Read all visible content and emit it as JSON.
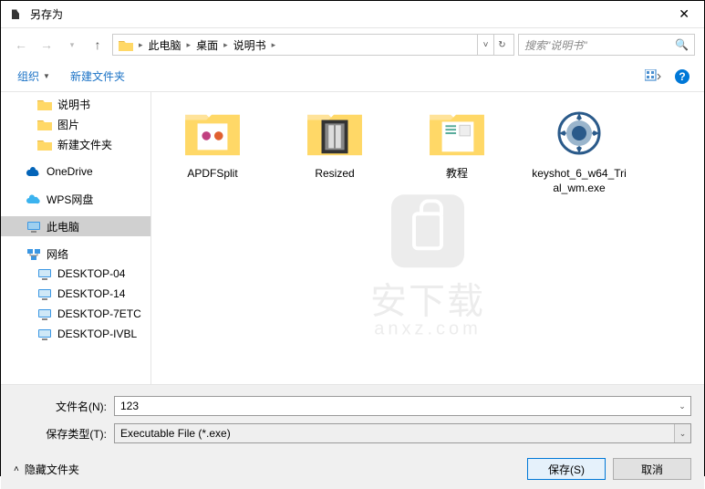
{
  "window": {
    "title": "另存为"
  },
  "breadcrumb": {
    "segs": [
      "此电脑",
      "桌面",
      "说明书"
    ]
  },
  "search": {
    "placeholder": "搜索\"说明书\""
  },
  "toolbar": {
    "organize": "组织",
    "newfolder": "新建文件夹"
  },
  "tree": [
    {
      "label": "说明书",
      "icon": "folder",
      "lvl": 2
    },
    {
      "label": "图片",
      "icon": "folder",
      "lvl": 2
    },
    {
      "label": "新建文件夹",
      "icon": "folder",
      "lvl": 2
    },
    {
      "label": "OneDrive",
      "icon": "onedrive",
      "lvl": 1
    },
    {
      "label": "WPS网盘",
      "icon": "wps",
      "lvl": 1
    },
    {
      "label": "此电脑",
      "icon": "thispc",
      "lvl": 1,
      "selected": true
    },
    {
      "label": "网络",
      "icon": "network",
      "lvl": 1
    },
    {
      "label": "DESKTOP-04",
      "icon": "computer",
      "lvl": 2
    },
    {
      "label": "DESKTOP-14",
      "icon": "computer",
      "lvl": 2
    },
    {
      "label": "DESKTOP-7ETC",
      "icon": "computer",
      "lvl": 2
    },
    {
      "label": "DESKTOP-IVBL",
      "icon": "computer",
      "lvl": 2
    }
  ],
  "items": [
    {
      "label": "APDFSplit",
      "type": "folder-thumb-1"
    },
    {
      "label": "Resized",
      "type": "folder-thumb-2"
    },
    {
      "label": "教程",
      "type": "folder-thumb-3"
    },
    {
      "label": "keyshot_6_w64_Trial_wm.exe",
      "type": "keyshot"
    }
  ],
  "form": {
    "filename_label": "文件名(N):",
    "filename_value": "123",
    "filetype_label": "保存类型(T):",
    "filetype_value": "Executable File (*.exe)"
  },
  "actions": {
    "hide": "隐藏文件夹",
    "save": "保存(S)",
    "cancel": "取消"
  },
  "watermark": {
    "text": "安下载",
    "sub": "anxz.com"
  }
}
